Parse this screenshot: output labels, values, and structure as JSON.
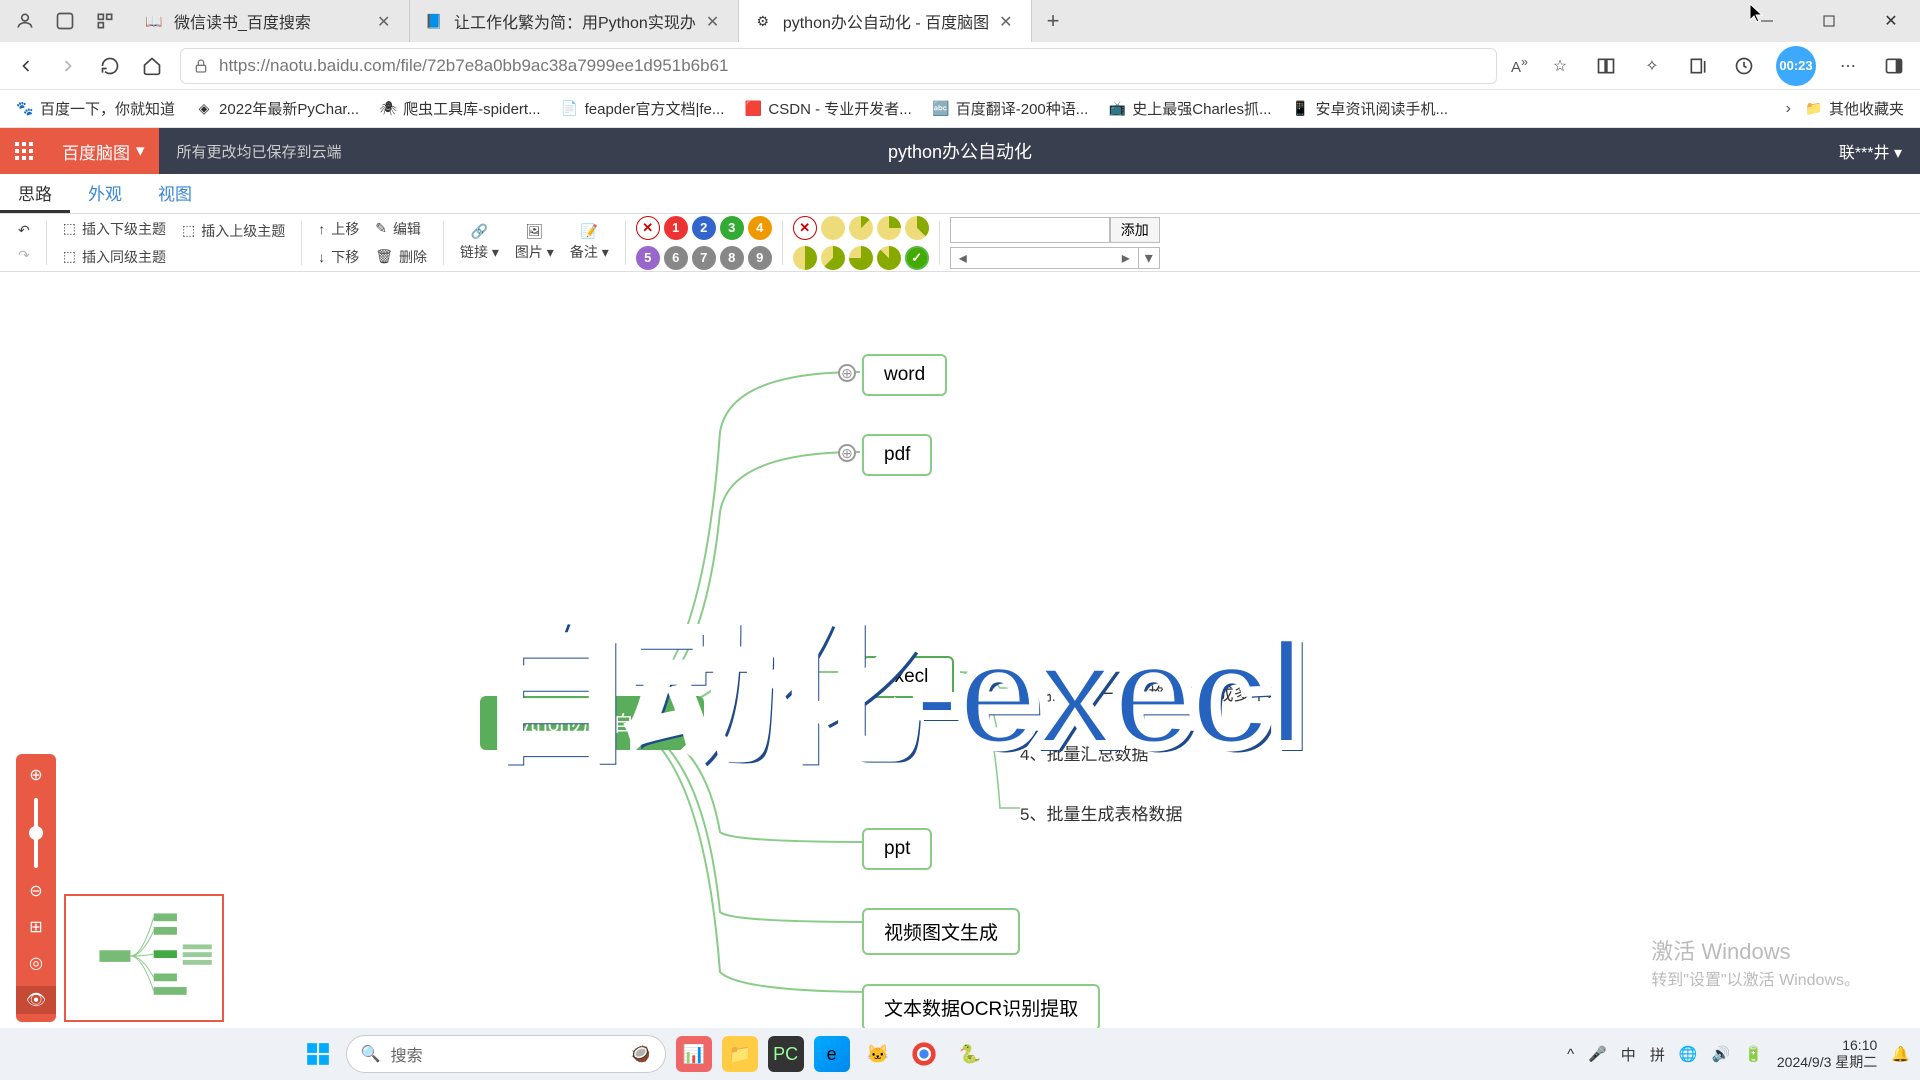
{
  "browser": {
    "tabs": [
      {
        "title": "微信读书_百度搜索",
        "favicon": "📖"
      },
      {
        "title": "让工作化繁为简：用Python实现办",
        "favicon": "📘"
      },
      {
        "title": "python办公自动化 - 百度脑图",
        "favicon": "⚙"
      }
    ],
    "url": "https://naotu.baidu.com/file/72b7e8a0bb9ac38a7999ee1d951b6b61",
    "timer": "00:23",
    "bookmarks": [
      {
        "icon": "🐾",
        "label": "百度一下，你就知道"
      },
      {
        "icon": "◈",
        "label": "2022年最新PyChar..."
      },
      {
        "icon": "🕷",
        "label": "爬虫工具库-spidert..."
      },
      {
        "icon": "📄",
        "label": "feapder官方文档|fe..."
      },
      {
        "icon": "🟥",
        "label": "CSDN - 专业开发者..."
      },
      {
        "icon": "🔤",
        "label": "百度翻译-200种语..."
      },
      {
        "icon": "📺",
        "label": "史上最强Charles抓..."
      },
      {
        "icon": "📱",
        "label": "安卓资讯阅读手机..."
      }
    ],
    "bookmark_folder": "其他收藏夹"
  },
  "app": {
    "brand": "百度脑图",
    "save_notice": "所有更改均已保存到云端",
    "doc_title": "python办公自动化",
    "user": "联***井",
    "view_tabs": [
      "思路",
      "外观",
      "视图"
    ],
    "toolbar": {
      "insert_child": "插入下级主题",
      "insert_parent": "插入上级主题",
      "insert_sibling": "插入同级主题",
      "move_up": "上移",
      "move_down": "下移",
      "edit": "编辑",
      "delete": "删除",
      "link": "链接",
      "image": "图片",
      "note": "备注",
      "tag_add": "添加"
    }
  },
  "mindmap": {
    "root": "python办公自动化",
    "nodes": {
      "word": "word",
      "pdf": "pdf",
      "excel": "execl",
      "ppt": "ppt",
      "video": "视频图文生成",
      "ocr": "文本数据OCR识别提取"
    },
    "excel_children": [
      "3、批量讲一个表格，拆分成多个表格",
      "4、批量汇总数据",
      "5、批量生成表格数据"
    ]
  },
  "overlay_text": "自动化-execl",
  "watermark": {
    "line1": "激活 Windows",
    "line2": "转到\"设置\"以激活 Windows。"
  },
  "taskbar": {
    "search_placeholder": "搜索",
    "ime1": "中",
    "ime2": "拼",
    "time": "16:10",
    "date": "2024/9/3 星期二"
  }
}
